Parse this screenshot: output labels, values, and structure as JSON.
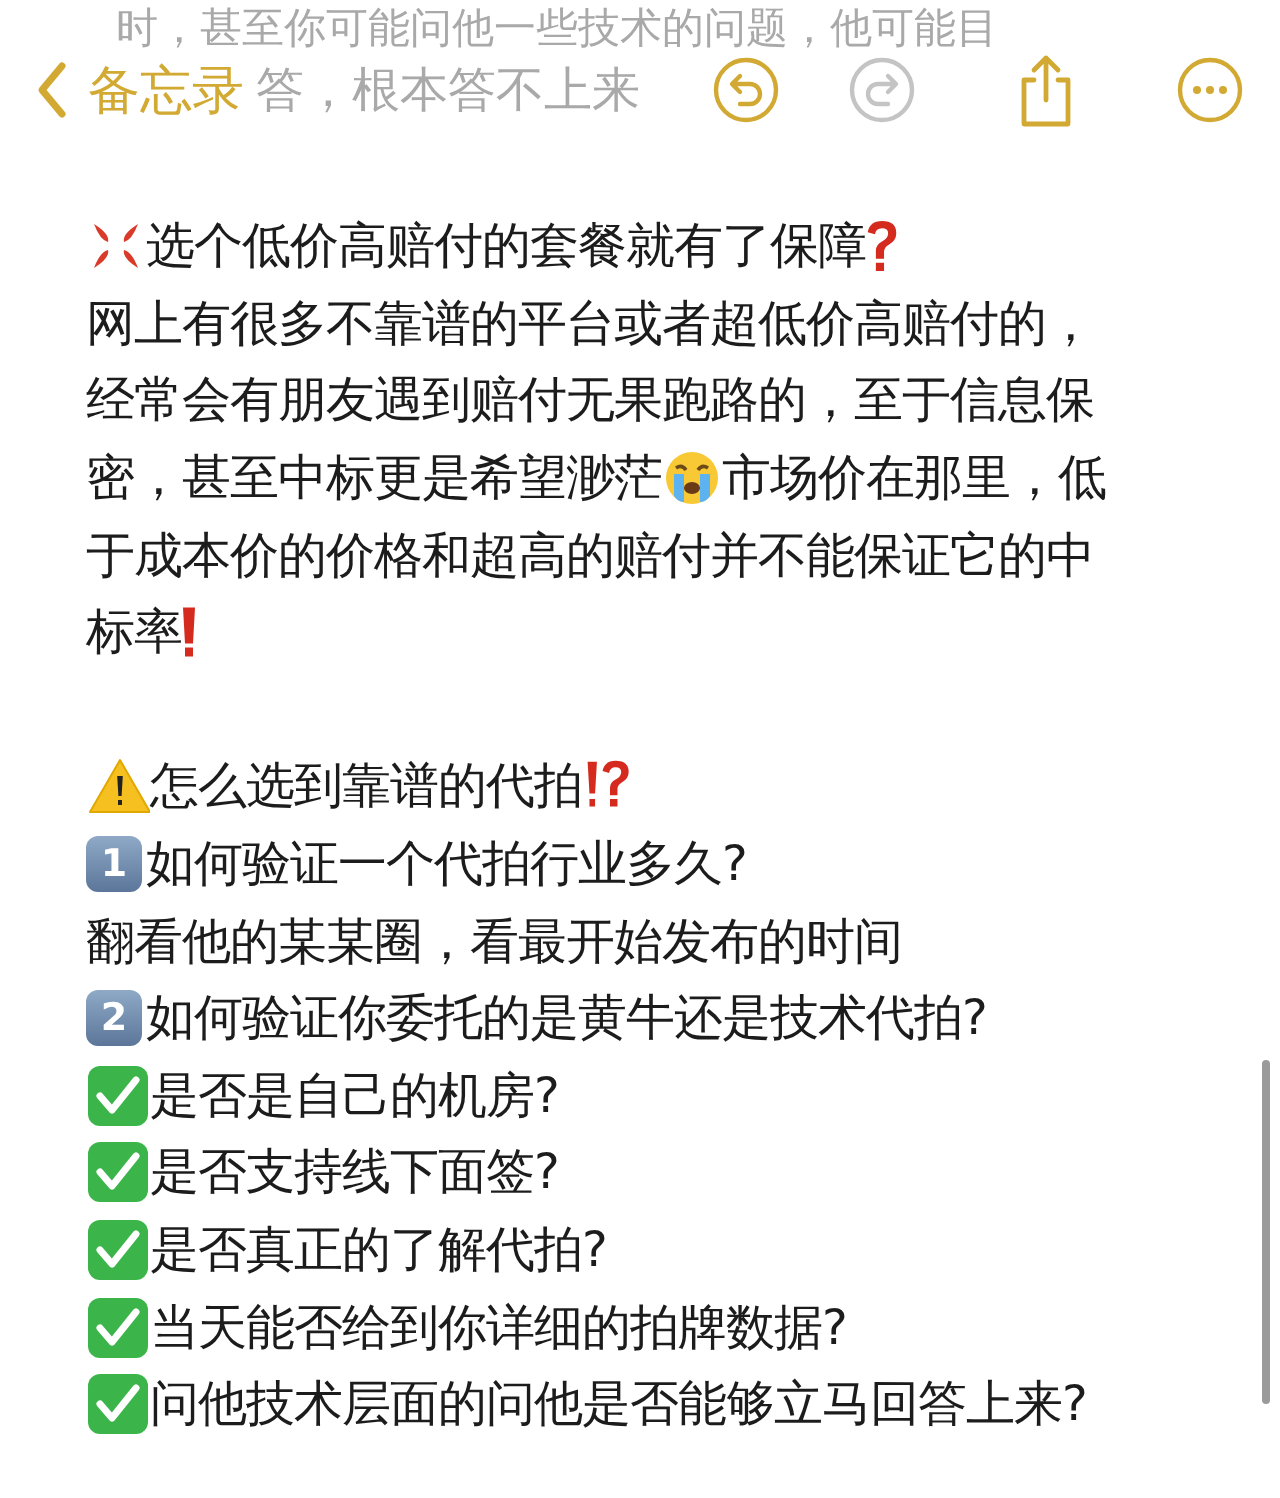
{
  "faded_text": {
    "line_1": "时，甚至你可能问他一些技术的问题，他可能目",
    "line_2": "答，根本答不上来"
  },
  "toolbar": {
    "back_label": "备忘录",
    "undo_disabled": false,
    "redo_disabled": true
  },
  "note_lines": [
    {
      "segments": [
        {
          "kind": "anger"
        },
        {
          "kind": "text",
          "text": "选个低价高赔付的套餐就有了保障"
        },
        {
          "kind": "question"
        }
      ]
    },
    {
      "segments": [
        {
          "kind": "text",
          "text": "网上有很多不靠谱的平台或者超低价高赔付的，"
        }
      ]
    },
    {
      "segments": [
        {
          "kind": "text",
          "text": "经常会有朋友遇到赔付无果跑路的，至于信息保"
        }
      ]
    },
    {
      "segments": [
        {
          "kind": "text",
          "text": "密，甚至中标更是希望渺茫"
        },
        {
          "kind": "crying"
        },
        {
          "kind": "text",
          "text": "市场价在那里，低"
        }
      ]
    },
    {
      "segments": [
        {
          "kind": "text",
          "text": "于成本价的价格和超高的赔付并不能保证它的中"
        }
      ]
    },
    {
      "segments": [
        {
          "kind": "text",
          "text": "标率"
        },
        {
          "kind": "exclaim"
        }
      ]
    },
    {
      "blank": true
    },
    {
      "segments": [
        {
          "kind": "warning"
        },
        {
          "kind": "text",
          "text": "怎么选到靠谱的代拍"
        },
        {
          "kind": "interrobang"
        }
      ]
    },
    {
      "segments": [
        {
          "kind": "keycap",
          "text": "1"
        },
        {
          "kind": "text",
          "text": " 如何验证一个代拍行业多久?"
        }
      ]
    },
    {
      "segments": [
        {
          "kind": "text",
          "text": "翻看他的某某圈，看最开始发布的时间"
        }
      ]
    },
    {
      "segments": [
        {
          "kind": "keycap",
          "text": "2"
        },
        {
          "kind": "text",
          "text": " 如何验证你委托的是黄牛还是技术代拍?"
        }
      ]
    },
    {
      "segments": [
        {
          "kind": "check"
        },
        {
          "kind": "text",
          "text": "是否是自己的机房?"
        }
      ]
    },
    {
      "segments": [
        {
          "kind": "check"
        },
        {
          "kind": "text",
          "text": "是否支持线下面签?"
        }
      ]
    },
    {
      "segments": [
        {
          "kind": "check"
        },
        {
          "kind": "text",
          "text": "是否真正的了解代拍?"
        }
      ]
    },
    {
      "segments": [
        {
          "kind": "check"
        },
        {
          "kind": "text",
          "text": "当天能否给到你详细的拍牌数据?"
        }
      ]
    },
    {
      "segments": [
        {
          "kind": "check"
        },
        {
          "kind": "text",
          "text": "问他技术层面的问他是否能够立马回答上来?"
        }
      ]
    }
  ]
}
